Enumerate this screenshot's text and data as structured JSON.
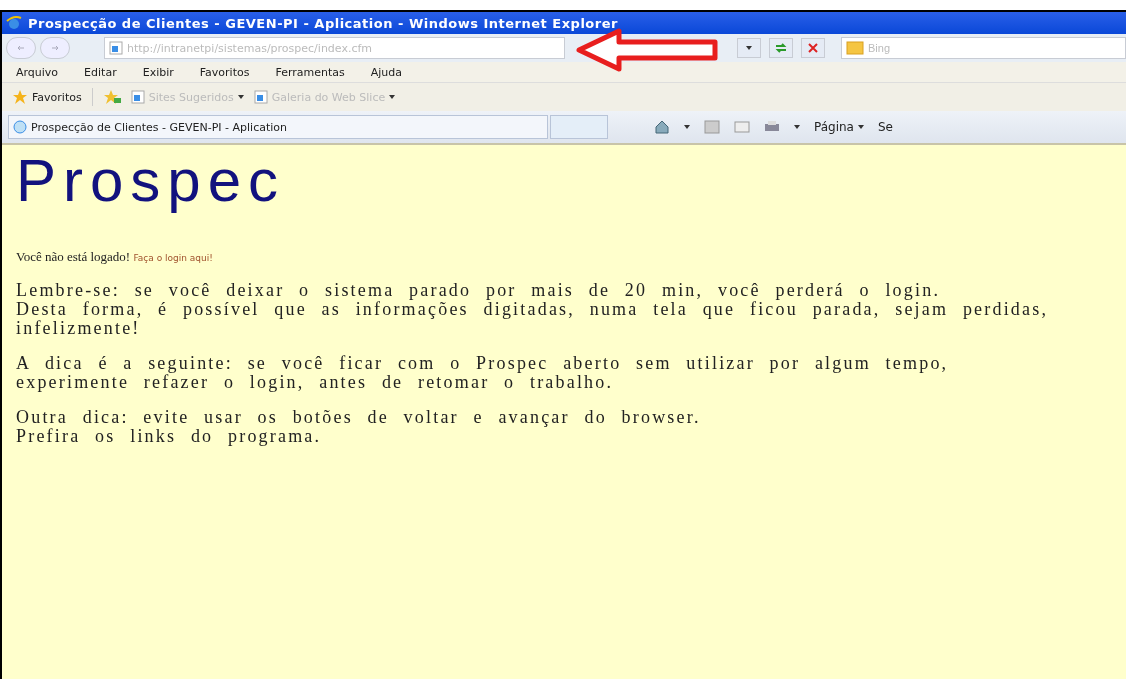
{
  "window": {
    "title": "Prospecção de Clientes - GEVEN-PI - Aplication - Windows Internet Explorer"
  },
  "address_bar": {
    "url": "http://intranetpi/sistemas/prospec/index.cfm",
    "search_placeholder": "Bing"
  },
  "menu": [
    "Arquivo",
    "Editar",
    "Exibir",
    "Favoritos",
    "Ferramentas",
    "Ajuda"
  ],
  "favorites_bar": {
    "label": "Favoritos",
    "links": [
      {
        "label": "Sites Sugeridos"
      },
      {
        "label": "Galeria do Web Slice"
      }
    ]
  },
  "tab": {
    "title": "Prospecção de Clientes - GEVEN-PI - Aplication"
  },
  "command_bar": {
    "page_menu": "Página",
    "cut_item": "Se"
  },
  "page": {
    "logo": "Prospec",
    "login_notice": {
      "text": "Você não está logado!",
      "link": "Faça o login aqui!"
    },
    "paragraphs": [
      {
        "lines": [
          "Lembre-se: se você deixar o sistema parado por mais de 20 min, você perderá o login.",
          "Desta forma, é possível que as informações digitadas, numa tela que ficou parada, sejam perdidas, infelizmente!"
        ]
      },
      {
        "lines": [
          "A dica é a seguinte: se você ficar com o Prospec aberto sem utilizar por algum tempo,",
          "experimente refazer o login, antes de retomar o trabalho."
        ]
      },
      {
        "lines": [
          "Outra dica: evite usar os botões de voltar e avançar do browser.",
          "Prefira os links do programa."
        ]
      }
    ]
  }
}
